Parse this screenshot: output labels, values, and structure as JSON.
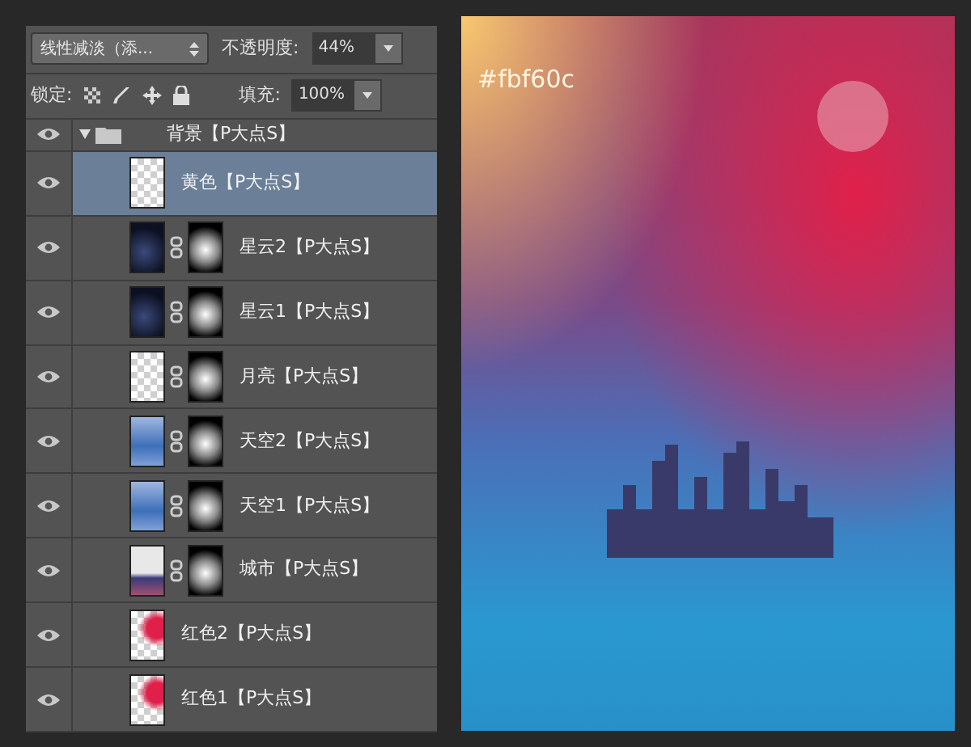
{
  "toolbar": {
    "blend_mode": "线性减淡（添...",
    "opacity_label": "不透明度:",
    "opacity": "44%",
    "lock_label": "锁定:",
    "fill_label": "填充:",
    "fill": "100%"
  },
  "group": {
    "name": "背景【P大点S】",
    "expanded": true,
    "visible": true
  },
  "layers": [
    {
      "name": "黄色【P大点S】",
      "kind": "plain",
      "thumbnail": {
        "kind": "checker"
      },
      "selected": true,
      "visible": true
    },
    {
      "name": "星云2【P大点S】",
      "kind": "masked",
      "thumbnail": {
        "kind": "stars"
      },
      "selected": false,
      "visible": true
    },
    {
      "name": "星云1【P大点S】",
      "kind": "masked",
      "thumbnail": {
        "kind": "stars"
      },
      "selected": false,
      "visible": true
    },
    {
      "name": "月亮【P大点S】",
      "kind": "masked",
      "thumbnail": {
        "kind": "checker"
      },
      "selected": false,
      "visible": true
    },
    {
      "name": "天空2【P大点S】",
      "kind": "masked",
      "thumbnail": {
        "kind": "sky"
      },
      "selected": false,
      "visible": true
    },
    {
      "name": "天空1【P大点S】",
      "kind": "masked",
      "thumbnail": {
        "kind": "sky"
      },
      "selected": false,
      "visible": true
    },
    {
      "name": "城市【P大点S】",
      "kind": "masked",
      "thumbnail": {
        "kind": "city"
      },
      "selected": false,
      "visible": true
    },
    {
      "name": "红色2【P大点S】",
      "kind": "plain",
      "thumbnail": {
        "kind": "red"
      },
      "selected": false,
      "visible": true
    },
    {
      "name": "红色1【P大点S】",
      "kind": "plain",
      "thumbnail": {
        "kind": "red"
      },
      "selected": false,
      "visible": true
    }
  ],
  "canvas": {
    "label": "#fbf60c"
  }
}
